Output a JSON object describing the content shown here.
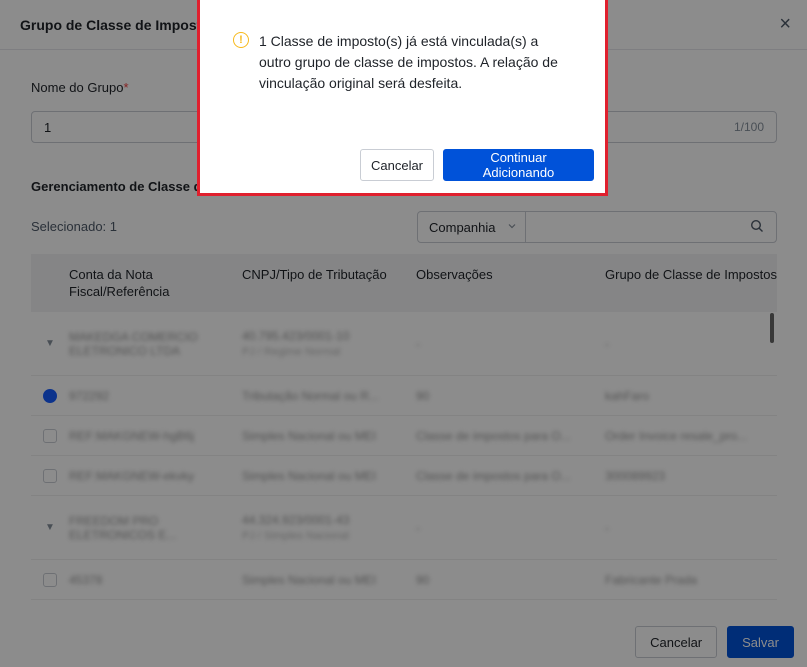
{
  "modal": {
    "title": "Grupo de Classe de Impostos",
    "close_icon": "close-icon",
    "name_label": "Nome do Grupo",
    "name_required": "*",
    "name_value": "1",
    "name_counter": "1/100",
    "section_title": "Gerenciamento de Classe d",
    "selected_text": "Selecionado: 1",
    "filter": {
      "select_value": "Companhia",
      "chevron_icon": "chevron-down-icon",
      "search_icon": "search-icon"
    },
    "table": {
      "headers": [
        "Conta da Nota Fiscal/Referência",
        "CNPJ/Tipo de Tributação",
        "Observações",
        "Grupo de Classe de Impostos"
      ],
      "rows": [
        {
          "kind": "expand",
          "c1": "MAKEDGA COMERCIO ELETRONICO LTDA",
          "c2": "40.795.423/0001-10",
          "c2sub": "PJ / Regime Normal",
          "c3": "-",
          "c4": "-"
        },
        {
          "kind": "checked",
          "c1": "972292",
          "c2": "Tributação Normal ou R...",
          "c3": "90",
          "c4": "kahFaro"
        },
        {
          "kind": "check",
          "c1": "REF:MAKGNEW-hgB6j",
          "c2": "Simples Nacional ou MEI",
          "c3": "Classe de impostos para O...",
          "c4": "Order Invoice resale_pro..."
        },
        {
          "kind": "check",
          "c1": "REF:MAKGNEW-ekvky",
          "c2": "Simples Nacional ou MEI",
          "c3": "Classe de impostos para O...",
          "c4": "300089923"
        },
        {
          "kind": "expand",
          "c1": "FREEDOM PRO ELETRONICOS E...",
          "c2": "44.324.923/0001-43",
          "c2sub": "PJ / Simples Nacional",
          "c3": "-",
          "c4": "-"
        },
        {
          "kind": "check",
          "c1": "45378",
          "c2": "Simples Nacional ou MEI",
          "c3": "90",
          "c4": "Fabricante Prada"
        }
      ]
    },
    "footer": {
      "cancel_label": "Cancelar",
      "save_label": "Salvar"
    }
  },
  "confirm": {
    "warning_icon": "warning-icon",
    "warning_glyph": "!",
    "message": "1 Classe de imposto(s) já está vinculada(s) a outro grupo de classe de impostos. A relação de vinculação original será desfeita.",
    "cancel_label": "Cancelar",
    "continue_label": "Continuar Adicionando"
  },
  "colors": {
    "primary": "#0052d9",
    "warning": "#f7ba1e",
    "highlight_border": "#e0202e",
    "required": "#f53f3f"
  }
}
